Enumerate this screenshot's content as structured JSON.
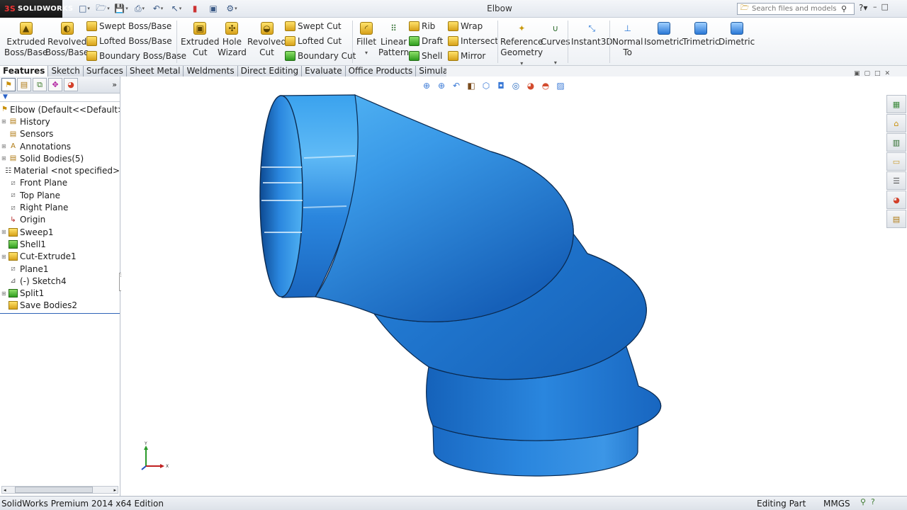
{
  "app": {
    "logo_text": "SOLIDWORKS",
    "logo_mark": "3S",
    "document_title": "Elbow",
    "search_placeholder": "Search files and models"
  },
  "ribbon": {
    "group1": {
      "extruded_boss_line1": "Extruded",
      "extruded_boss_line2": "Boss/Base",
      "revolved_boss_line1": "Revolved",
      "revolved_boss_line2": "Boss/Base",
      "swept_boss": "Swept Boss/Base",
      "lofted_boss": "Lofted Boss/Base",
      "boundary_boss": "Boundary Boss/Base"
    },
    "group2": {
      "extruded_cut_line1": "Extruded",
      "extruded_cut_line2": "Cut",
      "hole_wizard_line1": "Hole",
      "hole_wizard_line2": "Wizard",
      "revolved_cut_line1": "Revolved",
      "revolved_cut_line2": "Cut",
      "swept_cut": "Swept Cut",
      "lofted_cut": "Lofted Cut",
      "boundary_cut": "Boundary Cut"
    },
    "group3": {
      "fillet": "Fillet",
      "linear_pattern_line1": "Linear",
      "linear_pattern_line2": "Pattern",
      "rib": "Rib",
      "draft": "Draft",
      "shell": "Shell",
      "wrap": "Wrap",
      "intersect": "Intersect",
      "mirror": "Mirror"
    },
    "group4": {
      "reference_geometry_line1": "Reference",
      "reference_geometry_line2": "Geometry",
      "curves": "Curves",
      "instant3d": "Instant3D"
    },
    "views": {
      "normal_to_line1": "Normal",
      "normal_to_line2": "To",
      "isometric": "Isometric",
      "trimetric": "Trimetric",
      "dimetric": "Dimetric"
    }
  },
  "tabs": [
    "Features",
    "Sketch",
    "Surfaces",
    "Sheet Metal",
    "Weldments",
    "Direct Editing",
    "Evaluate",
    "Office Products",
    "Simulation"
  ],
  "tree": {
    "root": "Elbow  (Default<<Default>_D",
    "items": [
      {
        "label": "History",
        "expandable": true
      },
      {
        "label": "Sensors",
        "expandable": false
      },
      {
        "label": "Annotations",
        "expandable": true
      },
      {
        "label": "Solid Bodies(5)",
        "expandable": true
      },
      {
        "label": "Material <not specified>",
        "expandable": false
      },
      {
        "label": "Front Plane",
        "expandable": false
      },
      {
        "label": "Top Plane",
        "expandable": false
      },
      {
        "label": "Right Plane",
        "expandable": false
      },
      {
        "label": "Origin",
        "expandable": false
      },
      {
        "label": "Sweep1",
        "expandable": true
      },
      {
        "label": "Shell1",
        "expandable": false
      },
      {
        "label": "Cut-Extrude1",
        "expandable": true
      },
      {
        "label": "Plane1",
        "expandable": false
      },
      {
        "label": "(-) Sketch4",
        "expandable": false
      },
      {
        "label": "Split1",
        "expandable": true
      },
      {
        "label": "Save Bodies2",
        "expandable": false
      }
    ]
  },
  "triad": {
    "y_label": "Y",
    "x_label": "X"
  },
  "statusbar": {
    "edition": "SolidWorks Premium 2014 x64 Edition",
    "mode": "Editing Part",
    "units": "MMGS"
  },
  "colors": {
    "part_blue": "#2a86de",
    "part_dark": "#0e4f9a",
    "part_light": "#5fbaf6",
    "selection_blue": "#2f63b8"
  }
}
